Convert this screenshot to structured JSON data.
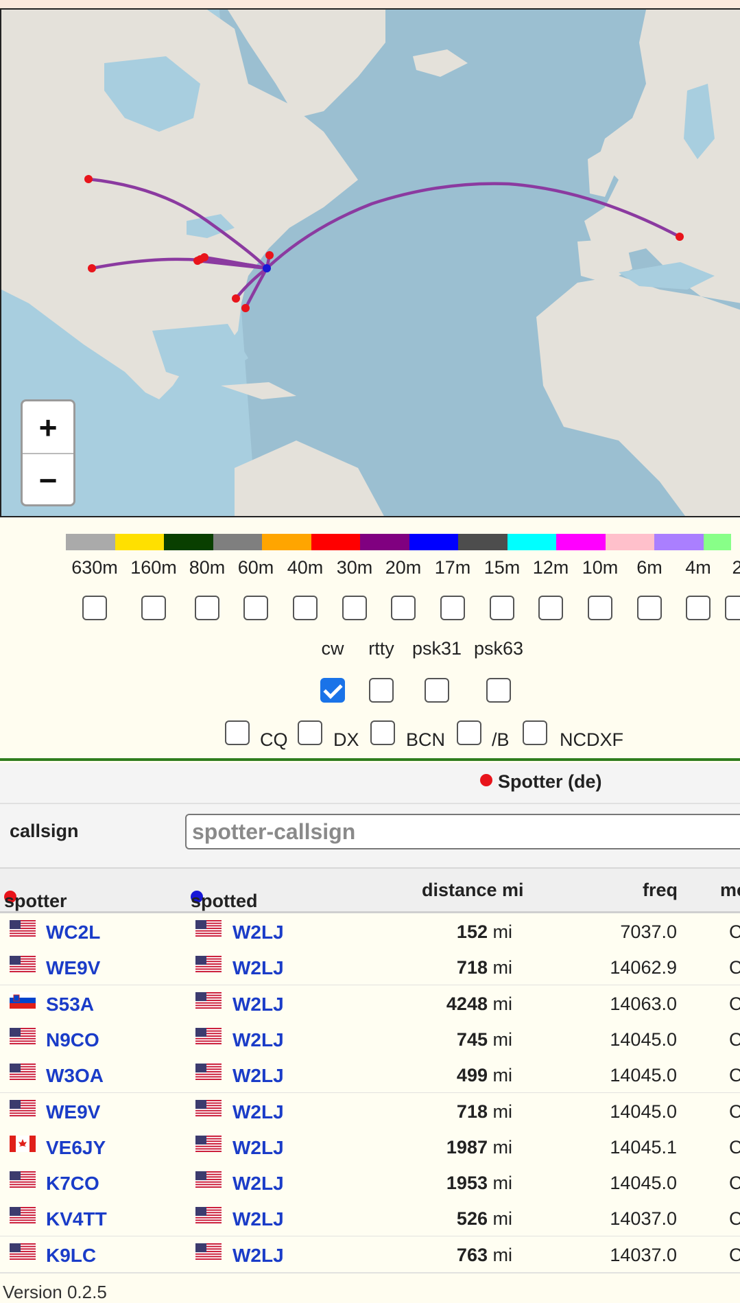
{
  "bands": {
    "colors": [
      "#aaaaaa",
      "#ffe000",
      "#093f00",
      "#7f7f7f",
      "#ffa500",
      "#ff0000",
      "#800080",
      "#0000ff",
      "#4d4d4d",
      "#00ffff",
      "#ff00ff",
      "#ffc0cb",
      "#aa7fff",
      "#88ff88"
    ],
    "labels": [
      "630m",
      "160m",
      "80m",
      "60m",
      "40m",
      "30m",
      "20m",
      "17m",
      "15m",
      "12m",
      "10m",
      "6m",
      "4m",
      "2"
    ]
  },
  "modes": {
    "labels": [
      "cw",
      "rtty",
      "psk31",
      "psk63"
    ],
    "checked": [
      true,
      false,
      false,
      false
    ]
  },
  "flags": {
    "labels": [
      "CQ",
      "DX",
      "BCN",
      "/B",
      "NCDXF"
    ]
  },
  "spotter_panel": {
    "title": "Spotter (de)",
    "callsign_label": "callsign",
    "callsign_placeholder": "spotter-callsign"
  },
  "table": {
    "headers": {
      "spotter": "spotter",
      "spotted": "spotted",
      "distance": "distance mi",
      "freq": "freq",
      "mode": "mo"
    },
    "rows": [
      {
        "flag": "us",
        "spotter": "WC2L",
        "spotted": "W2LJ",
        "dist": "152",
        "unit": "mi",
        "freq": "7037.0",
        "mode": "C"
      },
      {
        "flag": "us",
        "spotter": "WE9V",
        "spotted": "W2LJ",
        "dist": "718",
        "unit": "mi",
        "freq": "14062.9",
        "mode": "C"
      },
      {
        "flag": "si",
        "spotter": "S53A",
        "spotted": "W2LJ",
        "dist": "4248",
        "unit": "mi",
        "freq": "14063.0",
        "mode": "C"
      },
      {
        "flag": "us",
        "spotter": "N9CO",
        "spotted": "W2LJ",
        "dist": "745",
        "unit": "mi",
        "freq": "14045.0",
        "mode": "C"
      },
      {
        "flag": "us",
        "spotter": "W3OA",
        "spotted": "W2LJ",
        "dist": "499",
        "unit": "mi",
        "freq": "14045.0",
        "mode": "C"
      },
      {
        "flag": "us",
        "spotter": "WE9V",
        "spotted": "W2LJ",
        "dist": "718",
        "unit": "mi",
        "freq": "14045.0",
        "mode": "C"
      },
      {
        "flag": "ca",
        "spotter": "VE6JY",
        "spotted": "W2LJ",
        "dist": "1987",
        "unit": "mi",
        "freq": "14045.1",
        "mode": "C"
      },
      {
        "flag": "us",
        "spotter": "K7CO",
        "spotted": "W2LJ",
        "dist": "1953",
        "unit": "mi",
        "freq": "14045.0",
        "mode": "C"
      },
      {
        "flag": "us",
        "spotter": "KV4TT",
        "spotted": "W2LJ",
        "dist": "526",
        "unit": "mi",
        "freq": "14037.0",
        "mode": "C"
      },
      {
        "flag": "us",
        "spotter": "K9LC",
        "spotted": "W2LJ",
        "dist": "763",
        "unit": "mi",
        "freq": "14037.0",
        "mode": "C"
      }
    ]
  },
  "map": {
    "zoom_in": "+",
    "zoom_out": "−"
  },
  "colors": {
    "path": "#8b3aa0",
    "spotter_dot": "#e8141b",
    "spotted_dot": "#1717d6",
    "callsign_link": "#1a3cc8"
  },
  "footer": {
    "version": "Version 0.2.5"
  }
}
